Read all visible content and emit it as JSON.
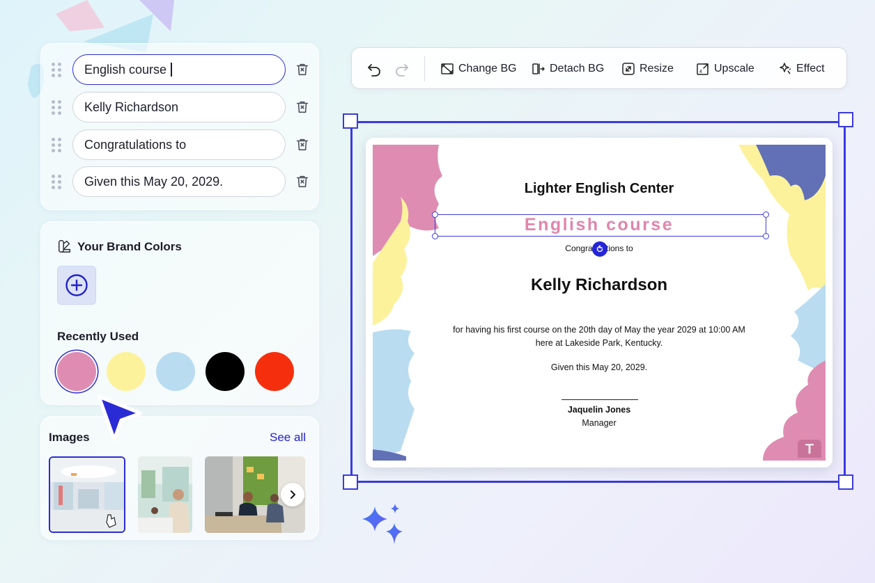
{
  "text_fields": [
    {
      "value": "English course",
      "active": true
    },
    {
      "value": "Kelly Richardson",
      "active": false
    },
    {
      "value": "Congratulations to",
      "active": false
    },
    {
      "value": "Given this May 20, 2029.",
      "active": false
    }
  ],
  "brand_colors": {
    "title": "Your Brand Colors",
    "recently_used_title": "Recently Used",
    "recently_used": [
      "#df8cb2",
      "#fcf29c",
      "#b9dcf1",
      "#000000",
      "#f52f0d"
    ],
    "selected_index": 0
  },
  "images": {
    "title": "Images",
    "see_all_label": "See all"
  },
  "toolbar": {
    "change_bg": "Change BG",
    "detach_bg": "Detach BG",
    "resize": "Resize",
    "upscale": "Upscale",
    "effect": "Effect"
  },
  "certificate": {
    "organization": "Lighter English Center",
    "course": "English course",
    "congrats": "Congratulations to",
    "recipient": "Kelly Richardson",
    "body_line1": "for having his first course on the 20th day of May the year 2029 at 10:00 AM",
    "body_line2": "here at Lakeside Park, Kentucky.",
    "date": "Given this May 20, 2029.",
    "signer": "Jaquelin Jones",
    "signer_role": "Manager",
    "logo_letter": "T"
  },
  "colors": {
    "accent": "#2b2bd6",
    "pink": "#df8cb2",
    "yellow": "#fcf29c",
    "light_blue": "#b9dcf1",
    "navy": "#6270b5"
  }
}
